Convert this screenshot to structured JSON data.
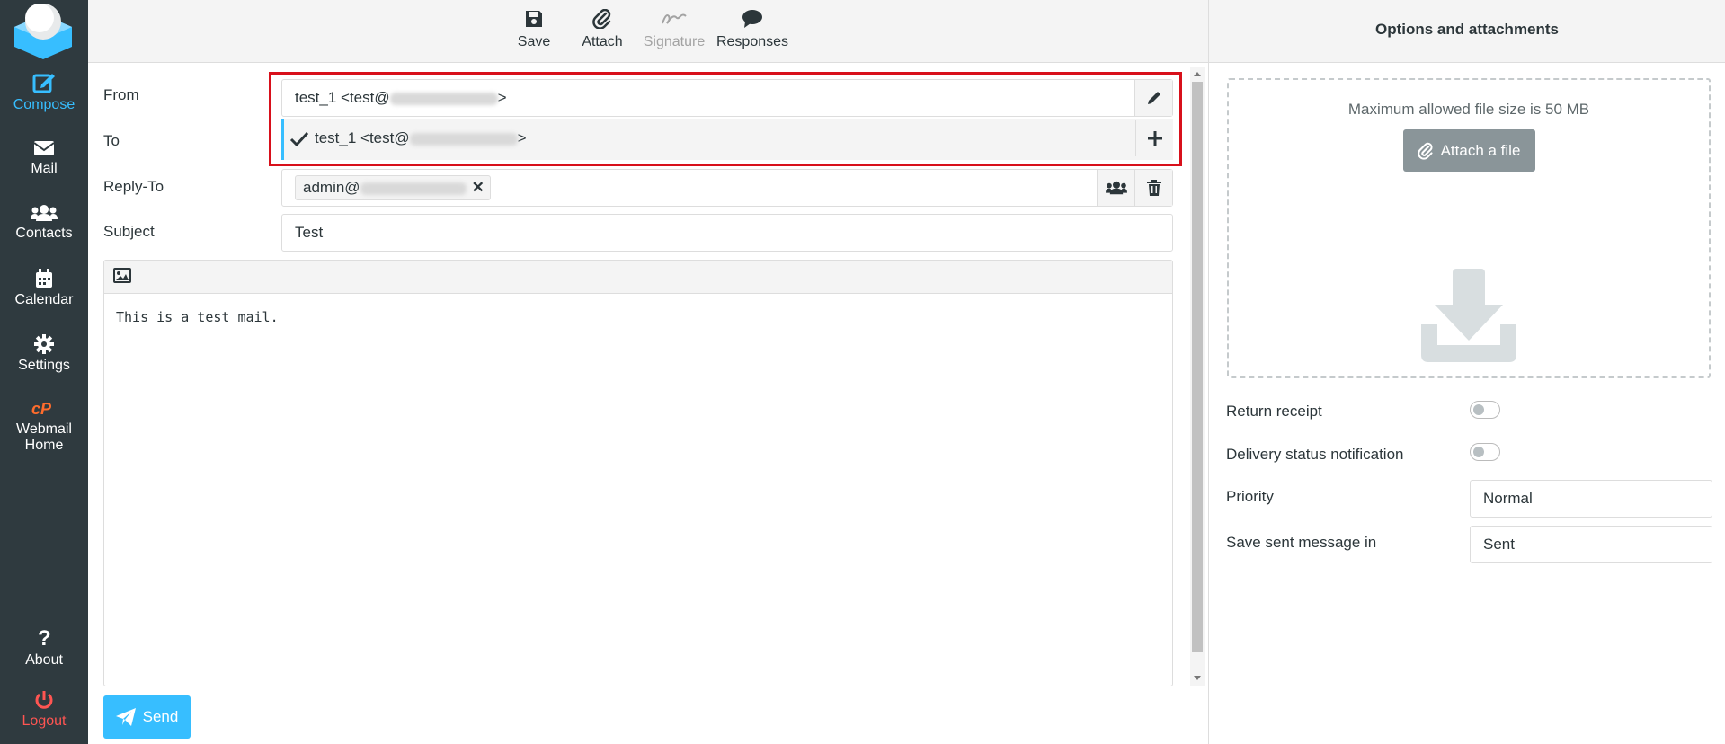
{
  "sidebar": {
    "items": [
      {
        "label": "Compose"
      },
      {
        "label": "Mail"
      },
      {
        "label": "Contacts"
      },
      {
        "label": "Calendar"
      },
      {
        "label": "Settings"
      },
      {
        "label": "Webmail Home"
      },
      {
        "label": "About"
      },
      {
        "label": "Logout"
      }
    ]
  },
  "toolbar": {
    "save_label": "Save",
    "attach_label": "Attach",
    "signature_label": "Signature",
    "responses_label": "Responses"
  },
  "form": {
    "from_label": "From",
    "from_value_prefix": "test_1 <test@",
    "from_value_suffix": ">",
    "to_label": "To",
    "dropdown_option_prefix": "test_1 <test@",
    "dropdown_option_suffix": ">",
    "replyto_label": "Reply-To",
    "replyto_recipient_prefix": "admin@",
    "subject_label": "Subject",
    "subject_value": "Test",
    "body_text": "This is a test mail.",
    "send_label": "Send"
  },
  "right_panel": {
    "title": "Options and attachments",
    "max_size_text": "Maximum allowed file size is 50 MB",
    "attach_file_label": "Attach a file",
    "return_receipt_label": "Return receipt",
    "return_receipt_on": false,
    "dsn_label": "Delivery status notification",
    "dsn_on": false,
    "priority_label": "Priority",
    "priority_value": "Normal",
    "save_sent_label": "Save sent message in",
    "save_sent_value": "Sent"
  },
  "colors": {
    "accent": "#37beff",
    "sidebar_bg": "#2f3a3f",
    "logout": "#ff5552",
    "highlight_border": "#d8101b"
  }
}
